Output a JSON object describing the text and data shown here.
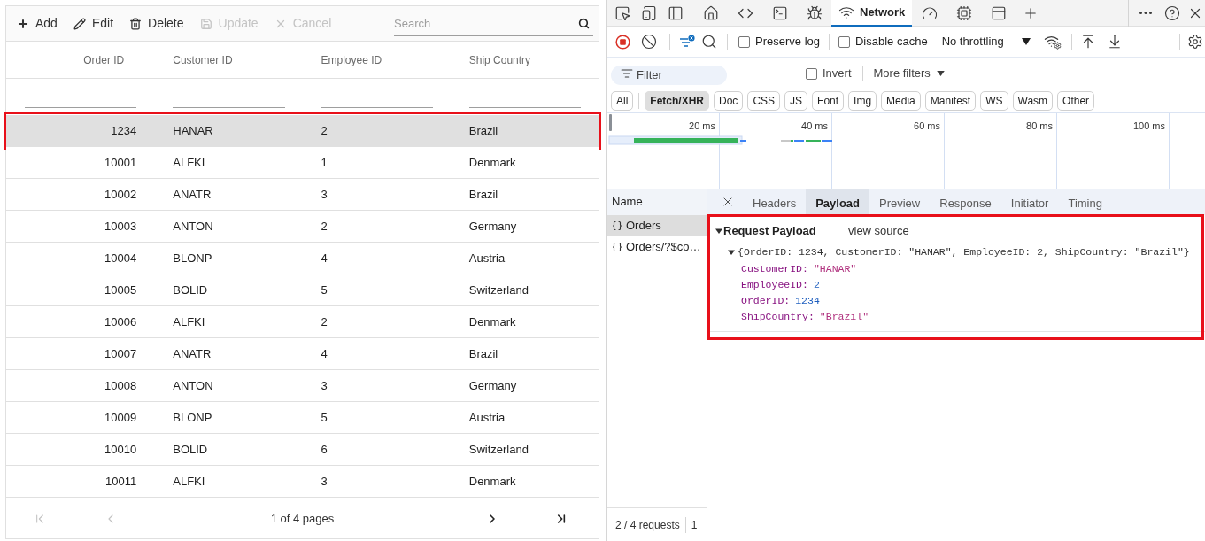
{
  "grid": {
    "toolbar": [
      {
        "kind": "add",
        "label": "Add",
        "disabled": false
      },
      {
        "kind": "edit",
        "label": "Edit",
        "disabled": false
      },
      {
        "kind": "delete",
        "label": "Delete",
        "disabled": false
      },
      {
        "kind": "update",
        "label": "Update",
        "disabled": true
      },
      {
        "kind": "cancel",
        "label": "Cancel",
        "disabled": true
      }
    ],
    "search": {
      "placeholder": "Search"
    },
    "columns": [
      {
        "label": "Order ID"
      },
      {
        "label": "Customer ID"
      },
      {
        "label": "Employee ID"
      },
      {
        "label": "Ship Country"
      }
    ],
    "rows": [
      {
        "cells": [
          "1234",
          "HANAR",
          "2",
          "Brazil"
        ],
        "selected": true,
        "highlighted": true
      },
      {
        "cells": [
          "10001",
          "ALFKI",
          "1",
          "Denmark"
        ],
        "selected": false,
        "highlighted": false
      },
      {
        "cells": [
          "10002",
          "ANATR",
          "3",
          "Brazil"
        ],
        "selected": false,
        "highlighted": false
      },
      {
        "cells": [
          "10003",
          "ANTON",
          "2",
          "Germany"
        ],
        "selected": false,
        "highlighted": false
      },
      {
        "cells": [
          "10004",
          "BLONP",
          "4",
          "Austria"
        ],
        "selected": false,
        "highlighted": false
      },
      {
        "cells": [
          "10005",
          "BOLID",
          "5",
          "Switzerland"
        ],
        "selected": false,
        "highlighted": false
      },
      {
        "cells": [
          "10006",
          "ALFKI",
          "2",
          "Denmark"
        ],
        "selected": false,
        "highlighted": false
      },
      {
        "cells": [
          "10007",
          "ANATR",
          "4",
          "Brazil"
        ],
        "selected": false,
        "highlighted": false
      },
      {
        "cells": [
          "10008",
          "ANTON",
          "3",
          "Germany"
        ],
        "selected": false,
        "highlighted": false
      },
      {
        "cells": [
          "10009",
          "BLONP",
          "5",
          "Austria"
        ],
        "selected": false,
        "highlighted": false
      },
      {
        "cells": [
          "10010",
          "BOLID",
          "6",
          "Switzerland"
        ],
        "selected": false,
        "highlighted": false
      },
      {
        "cells": [
          "10011",
          "ALFKI",
          "3",
          "Denmark"
        ],
        "selected": false,
        "highlighted": false
      }
    ],
    "pager": {
      "buttons": [
        {
          "kind": "first",
          "disabled": true
        },
        {
          "kind": "previous",
          "disabled": true
        },
        {
          "kind": "next",
          "disabled": false
        },
        {
          "kind": "last",
          "disabled": false
        }
      ],
      "summary": "1 of 4 pages"
    }
  },
  "devtools": {
    "panel_tabs": [
      {
        "kind": "welcome",
        "selected": false
      },
      {
        "kind": "elements",
        "selected": false
      },
      {
        "kind": "console",
        "selected": false
      },
      {
        "kind": "sources",
        "selected": false
      },
      {
        "kind": "network",
        "label": "Network",
        "selected": true
      },
      {
        "kind": "performance",
        "selected": false
      },
      {
        "kind": "memory",
        "selected": false
      },
      {
        "kind": "application",
        "selected": false
      }
    ],
    "recording": true,
    "preserve_log": {
      "label": "Preserve log",
      "checked": false
    },
    "disable_cache": {
      "label": "Disable cache",
      "checked": false
    },
    "throttling": {
      "value": "No throttling"
    },
    "filter": {
      "placeholder": "Filter"
    },
    "invert": {
      "label": "Invert",
      "checked": false
    },
    "more_filters": {
      "label": "More filters"
    },
    "type_filters": [
      {
        "label": "All",
        "selected": false
      },
      {
        "label": "Fetch/XHR",
        "selected": true
      },
      {
        "label": "Doc",
        "selected": false
      },
      {
        "label": "CSS",
        "selected": false
      },
      {
        "label": "JS",
        "selected": false
      },
      {
        "label": "Font",
        "selected": false
      },
      {
        "label": "Img",
        "selected": false
      },
      {
        "label": "Media",
        "selected": false
      },
      {
        "label": "Manifest",
        "selected": false
      },
      {
        "label": "WS",
        "selected": false
      },
      {
        "label": "Wasm",
        "selected": false
      },
      {
        "label": "Other",
        "selected": false
      }
    ],
    "timeline": {
      "ticks": [
        "20 ms",
        "40 ms",
        "60 ms",
        "80 ms",
        "100 ms"
      ]
    },
    "requests": {
      "header": "Name",
      "items": [
        {
          "name": "Orders",
          "selected": true
        },
        {
          "name": "Orders/?$co…",
          "selected": false
        }
      ]
    },
    "status": [
      "2 / 4 requests",
      "1"
    ],
    "detail_tabs": [
      {
        "label": "Headers",
        "selected": false
      },
      {
        "label": "Payload",
        "selected": true
      },
      {
        "label": "Preview",
        "selected": false
      },
      {
        "label": "Response",
        "selected": false
      },
      {
        "label": "Initiator",
        "selected": false
      },
      {
        "label": "Timing",
        "selected": false
      }
    ],
    "payload": {
      "title": "Request Payload",
      "view_source": "view source",
      "expanded": true,
      "highlighted": true,
      "tree_expanded": true,
      "summary": "{OrderID: 1234, CustomerID: \"HANAR\", EmployeeID: 2, ShipCountry: \"Brazil\"}",
      "properties": [
        {
          "key": "CustomerID:",
          "value": "\"HANAR\"",
          "kind": "string"
        },
        {
          "key": "EmployeeID:",
          "value": "2",
          "kind": "number"
        },
        {
          "key": "OrderID:",
          "value": "1234",
          "kind": "number"
        },
        {
          "key": "ShipCountry:",
          "value": "\"Brazil\"",
          "kind": "string"
        }
      ]
    }
  }
}
